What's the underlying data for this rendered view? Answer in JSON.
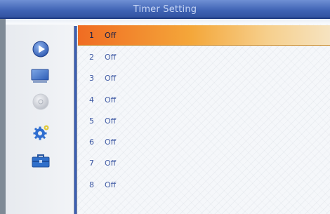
{
  "header": {
    "title": "Timer Setting"
  },
  "sidebar": {
    "icons": [
      {
        "name": "play-icon"
      },
      {
        "name": "monitor-icon"
      },
      {
        "name": "disc-icon"
      },
      {
        "name": "settings-icon"
      },
      {
        "name": "toolbox-icon"
      }
    ]
  },
  "timers": [
    {
      "number": "1",
      "status": "Off",
      "selected": true
    },
    {
      "number": "2",
      "status": "Off"
    },
    {
      "number": "3",
      "status": "Off"
    },
    {
      "number": "4",
      "status": "Off"
    },
    {
      "number": "5",
      "status": "Off"
    },
    {
      "number": "6",
      "status": "Off"
    },
    {
      "number": "7",
      "status": "Off"
    },
    {
      "number": "8",
      "status": "Off"
    }
  ],
  "colors": {
    "header": "#3f63b4",
    "selection": "#f06c22",
    "text": "#3f5aa4"
  }
}
